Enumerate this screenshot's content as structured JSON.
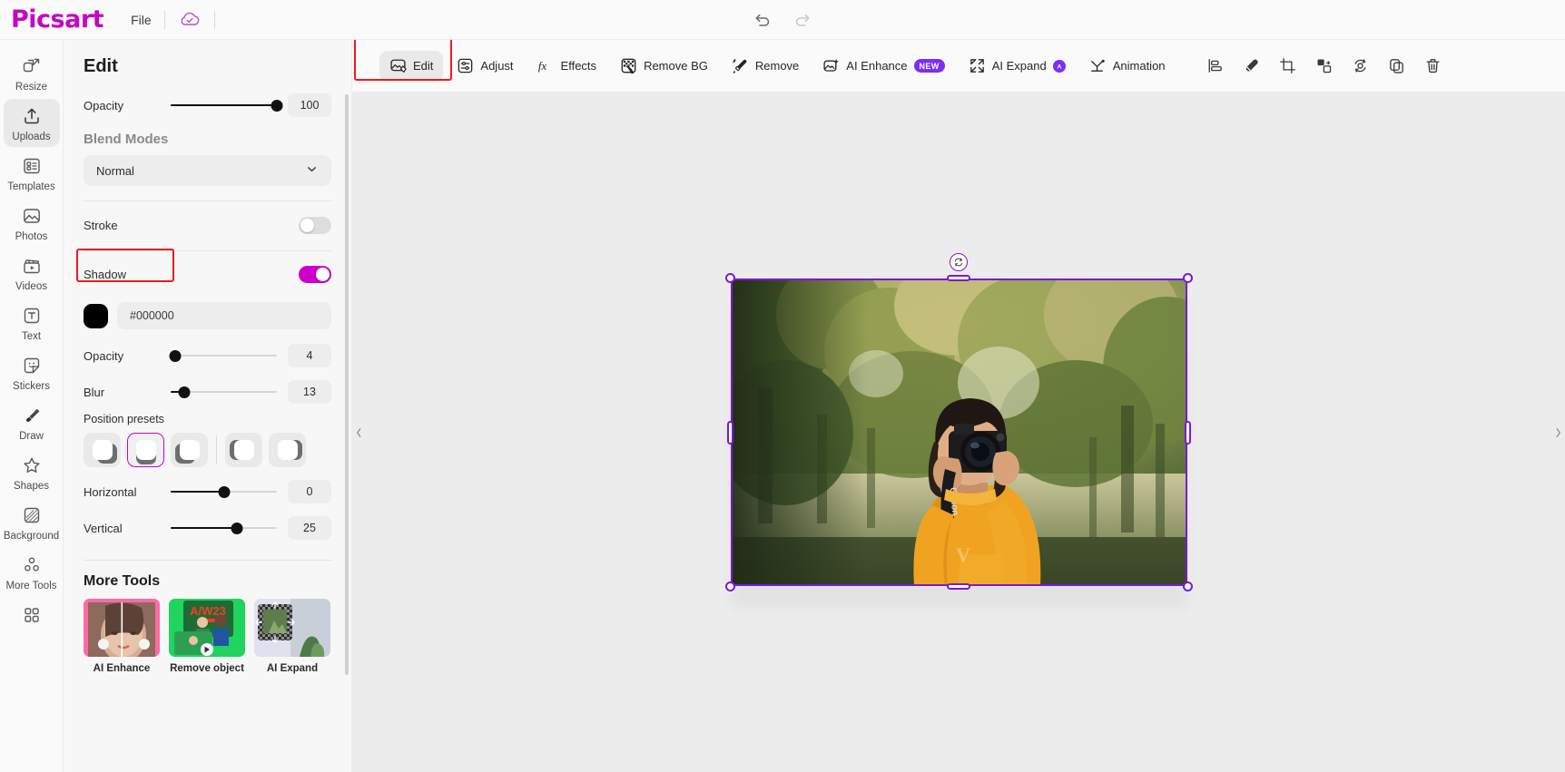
{
  "app": {
    "brand": "Picsart",
    "file_menu": "File",
    "cloud_icon": "cloud-check-icon",
    "undo_icon": "undo-arrow-icon",
    "redo_icon": "redo-arrow-icon"
  },
  "rail": {
    "items": [
      {
        "label": "Resize",
        "icon": "resize-icon",
        "active": false
      },
      {
        "label": "Uploads",
        "icon": "upload-icon",
        "active": true
      },
      {
        "label": "Templates",
        "icon": "templates-icon",
        "active": false
      },
      {
        "label": "Photos",
        "icon": "photo-icon",
        "active": false
      },
      {
        "label": "Videos",
        "icon": "video-clapper-icon",
        "active": false
      },
      {
        "label": "Text",
        "icon": "text-icon",
        "active": false
      },
      {
        "label": "Stickers",
        "icon": "sticker-icon",
        "active": false
      },
      {
        "label": "Draw",
        "icon": "brush-icon",
        "active": false
      },
      {
        "label": "Shapes",
        "icon": "star-icon",
        "active": false
      },
      {
        "label": "Background",
        "icon": "background-icon",
        "active": false
      },
      {
        "label": "More Tools",
        "icon": "more-tools-icon",
        "active": false
      },
      {
        "label": "",
        "icon": "apps-grid-icon",
        "active": false
      }
    ]
  },
  "panel": {
    "title": "Edit",
    "opacity": {
      "label": "Opacity",
      "value": "100",
      "percent": 100
    },
    "blend": {
      "heading": "Blend Modes",
      "selected": "Normal",
      "chevron": "chevron-down-icon"
    },
    "stroke": {
      "label": "Stroke",
      "enabled": false
    },
    "shadow": {
      "label": "Shadow",
      "enabled": true,
      "color_hex": "#000000",
      "opacity": {
        "label": "Opacity",
        "value": "4",
        "percent": 4
      },
      "blur": {
        "label": "Blur",
        "value": "13",
        "percent": 13
      },
      "presets_label": "Position presets",
      "preset_selected_index": 1,
      "horizontal": {
        "label": "Horizontal",
        "value": "0",
        "percent": 50
      },
      "vertical": {
        "label": "Vertical",
        "value": "25",
        "percent": 62
      }
    },
    "more_tools": {
      "title": "More Tools",
      "items": [
        {
          "label": "AI Enhance"
        },
        {
          "label": "Remove object"
        },
        {
          "label": "AI Expand"
        }
      ]
    }
  },
  "toolbar": {
    "tools": [
      {
        "label": "Edit",
        "icon": "edit-image-icon",
        "active": true,
        "badge": null
      },
      {
        "label": "Adjust",
        "icon": "sliders-icon",
        "active": false,
        "badge": null
      },
      {
        "label": "Effects",
        "icon": "fx-icon",
        "active": false,
        "badge": null
      },
      {
        "label": "Remove BG",
        "icon": "remove-bg-icon",
        "active": false,
        "badge": null
      },
      {
        "label": "Remove",
        "icon": "eraser-wand-icon",
        "active": false,
        "badge": null
      },
      {
        "label": "AI Enhance",
        "icon": "ai-enhance-icon",
        "active": false,
        "badge": "NEW"
      },
      {
        "label": "AI Expand",
        "icon": "expand-arrows-icon",
        "active": false,
        "badge": "AI"
      },
      {
        "label": "Animation",
        "icon": "animation-icon",
        "active": false,
        "badge": null
      }
    ],
    "icon_buttons": [
      {
        "icon": "align-icon"
      },
      {
        "icon": "eraser-icon"
      },
      {
        "icon": "crop-icon"
      },
      {
        "icon": "arrange-layers-icon"
      },
      {
        "icon": "flip-rotate-icon"
      },
      {
        "icon": "duplicate-icon"
      },
      {
        "icon": "trash-icon"
      }
    ]
  },
  "canvas": {
    "collapse_left_icon": "chevron-left-icon",
    "collapse_right_icon": "chevron-right-icon",
    "selection": {
      "rotate_icon": "rotate-icon",
      "accent": "#7a18d6"
    },
    "image_alt": "woman-photographer-with-camera"
  },
  "highlights": {
    "accent": "#f01b1b",
    "boxes": [
      {
        "name": "edit-tab-highlight"
      },
      {
        "name": "shadow-label-highlight"
      }
    ]
  }
}
